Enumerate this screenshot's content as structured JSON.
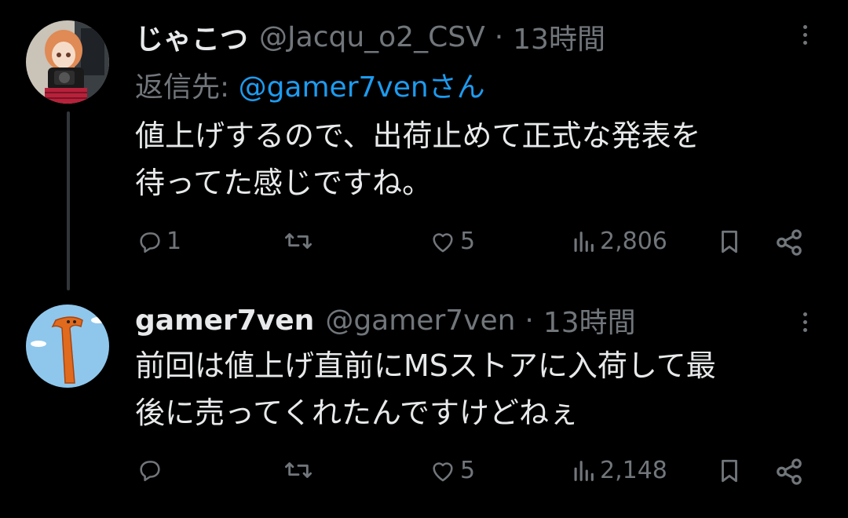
{
  "tweets": [
    {
      "name": "じゃこつ",
      "handle": "@Jacqu_o2_CSV",
      "separator": "·",
      "time": "13時間",
      "reply_prefix": "返信先: ",
      "reply_mention": "@gamer7venさん",
      "text": "値上げするので、出荷止めて正式な発表を\n待ってた感じですね。",
      "replies": "1",
      "retweets": "",
      "likes": "5",
      "views": "2,806",
      "avatar_icon": "anime-girl-avatar"
    },
    {
      "name": "gamer7ven",
      "handle": "@gamer7ven",
      "separator": "·",
      "time": "13時間",
      "text": "前回は値上げ直前にMSストアに入荷して最\n後に売ってくれたんですけどねぇ",
      "replies": "",
      "retweets": "",
      "likes": "5",
      "views": "2,148",
      "avatar_icon": "orange-tube-man-avatar"
    }
  ],
  "colors": {
    "background": "#000000",
    "text": "#e7e9ea",
    "muted": "#71767b",
    "link": "#1d9bf0"
  }
}
